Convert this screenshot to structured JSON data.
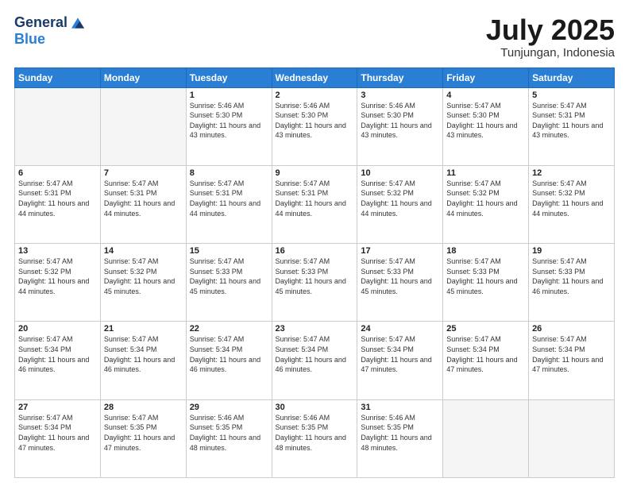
{
  "header": {
    "logo_general": "General",
    "logo_blue": "Blue",
    "month_title": "July 2025",
    "location": "Tunjungan, Indonesia"
  },
  "weekdays": [
    "Sunday",
    "Monday",
    "Tuesday",
    "Wednesday",
    "Thursday",
    "Friday",
    "Saturday"
  ],
  "weeks": [
    [
      {
        "day": "",
        "sunrise": "",
        "sunset": "",
        "daylight": ""
      },
      {
        "day": "",
        "sunrise": "",
        "sunset": "",
        "daylight": ""
      },
      {
        "day": "1",
        "sunrise": "Sunrise: 5:46 AM",
        "sunset": "Sunset: 5:30 PM",
        "daylight": "Daylight: 11 hours and 43 minutes."
      },
      {
        "day": "2",
        "sunrise": "Sunrise: 5:46 AM",
        "sunset": "Sunset: 5:30 PM",
        "daylight": "Daylight: 11 hours and 43 minutes."
      },
      {
        "day": "3",
        "sunrise": "Sunrise: 5:46 AM",
        "sunset": "Sunset: 5:30 PM",
        "daylight": "Daylight: 11 hours and 43 minutes."
      },
      {
        "day": "4",
        "sunrise": "Sunrise: 5:47 AM",
        "sunset": "Sunset: 5:30 PM",
        "daylight": "Daylight: 11 hours and 43 minutes."
      },
      {
        "day": "5",
        "sunrise": "Sunrise: 5:47 AM",
        "sunset": "Sunset: 5:31 PM",
        "daylight": "Daylight: 11 hours and 43 minutes."
      }
    ],
    [
      {
        "day": "6",
        "sunrise": "Sunrise: 5:47 AM",
        "sunset": "Sunset: 5:31 PM",
        "daylight": "Daylight: 11 hours and 44 minutes."
      },
      {
        "day": "7",
        "sunrise": "Sunrise: 5:47 AM",
        "sunset": "Sunset: 5:31 PM",
        "daylight": "Daylight: 11 hours and 44 minutes."
      },
      {
        "day": "8",
        "sunrise": "Sunrise: 5:47 AM",
        "sunset": "Sunset: 5:31 PM",
        "daylight": "Daylight: 11 hours and 44 minutes."
      },
      {
        "day": "9",
        "sunrise": "Sunrise: 5:47 AM",
        "sunset": "Sunset: 5:31 PM",
        "daylight": "Daylight: 11 hours and 44 minutes."
      },
      {
        "day": "10",
        "sunrise": "Sunrise: 5:47 AM",
        "sunset": "Sunset: 5:32 PM",
        "daylight": "Daylight: 11 hours and 44 minutes."
      },
      {
        "day": "11",
        "sunrise": "Sunrise: 5:47 AM",
        "sunset": "Sunset: 5:32 PM",
        "daylight": "Daylight: 11 hours and 44 minutes."
      },
      {
        "day": "12",
        "sunrise": "Sunrise: 5:47 AM",
        "sunset": "Sunset: 5:32 PM",
        "daylight": "Daylight: 11 hours and 44 minutes."
      }
    ],
    [
      {
        "day": "13",
        "sunrise": "Sunrise: 5:47 AM",
        "sunset": "Sunset: 5:32 PM",
        "daylight": "Daylight: 11 hours and 44 minutes."
      },
      {
        "day": "14",
        "sunrise": "Sunrise: 5:47 AM",
        "sunset": "Sunset: 5:32 PM",
        "daylight": "Daylight: 11 hours and 45 minutes."
      },
      {
        "day": "15",
        "sunrise": "Sunrise: 5:47 AM",
        "sunset": "Sunset: 5:33 PM",
        "daylight": "Daylight: 11 hours and 45 minutes."
      },
      {
        "day": "16",
        "sunrise": "Sunrise: 5:47 AM",
        "sunset": "Sunset: 5:33 PM",
        "daylight": "Daylight: 11 hours and 45 minutes."
      },
      {
        "day": "17",
        "sunrise": "Sunrise: 5:47 AM",
        "sunset": "Sunset: 5:33 PM",
        "daylight": "Daylight: 11 hours and 45 minutes."
      },
      {
        "day": "18",
        "sunrise": "Sunrise: 5:47 AM",
        "sunset": "Sunset: 5:33 PM",
        "daylight": "Daylight: 11 hours and 45 minutes."
      },
      {
        "day": "19",
        "sunrise": "Sunrise: 5:47 AM",
        "sunset": "Sunset: 5:33 PM",
        "daylight": "Daylight: 11 hours and 46 minutes."
      }
    ],
    [
      {
        "day": "20",
        "sunrise": "Sunrise: 5:47 AM",
        "sunset": "Sunset: 5:34 PM",
        "daylight": "Daylight: 11 hours and 46 minutes."
      },
      {
        "day": "21",
        "sunrise": "Sunrise: 5:47 AM",
        "sunset": "Sunset: 5:34 PM",
        "daylight": "Daylight: 11 hours and 46 minutes."
      },
      {
        "day": "22",
        "sunrise": "Sunrise: 5:47 AM",
        "sunset": "Sunset: 5:34 PM",
        "daylight": "Daylight: 11 hours and 46 minutes."
      },
      {
        "day": "23",
        "sunrise": "Sunrise: 5:47 AM",
        "sunset": "Sunset: 5:34 PM",
        "daylight": "Daylight: 11 hours and 46 minutes."
      },
      {
        "day": "24",
        "sunrise": "Sunrise: 5:47 AM",
        "sunset": "Sunset: 5:34 PM",
        "daylight": "Daylight: 11 hours and 47 minutes."
      },
      {
        "day": "25",
        "sunrise": "Sunrise: 5:47 AM",
        "sunset": "Sunset: 5:34 PM",
        "daylight": "Daylight: 11 hours and 47 minutes."
      },
      {
        "day": "26",
        "sunrise": "Sunrise: 5:47 AM",
        "sunset": "Sunset: 5:34 PM",
        "daylight": "Daylight: 11 hours and 47 minutes."
      }
    ],
    [
      {
        "day": "27",
        "sunrise": "Sunrise: 5:47 AM",
        "sunset": "Sunset: 5:34 PM",
        "daylight": "Daylight: 11 hours and 47 minutes."
      },
      {
        "day": "28",
        "sunrise": "Sunrise: 5:47 AM",
        "sunset": "Sunset: 5:35 PM",
        "daylight": "Daylight: 11 hours and 47 minutes."
      },
      {
        "day": "29",
        "sunrise": "Sunrise: 5:46 AM",
        "sunset": "Sunset: 5:35 PM",
        "daylight": "Daylight: 11 hours and 48 minutes."
      },
      {
        "day": "30",
        "sunrise": "Sunrise: 5:46 AM",
        "sunset": "Sunset: 5:35 PM",
        "daylight": "Daylight: 11 hours and 48 minutes."
      },
      {
        "day": "31",
        "sunrise": "Sunrise: 5:46 AM",
        "sunset": "Sunset: 5:35 PM",
        "daylight": "Daylight: 11 hours and 48 minutes."
      },
      {
        "day": "",
        "sunrise": "",
        "sunset": "",
        "daylight": ""
      },
      {
        "day": "",
        "sunrise": "",
        "sunset": "",
        "daylight": ""
      }
    ]
  ]
}
